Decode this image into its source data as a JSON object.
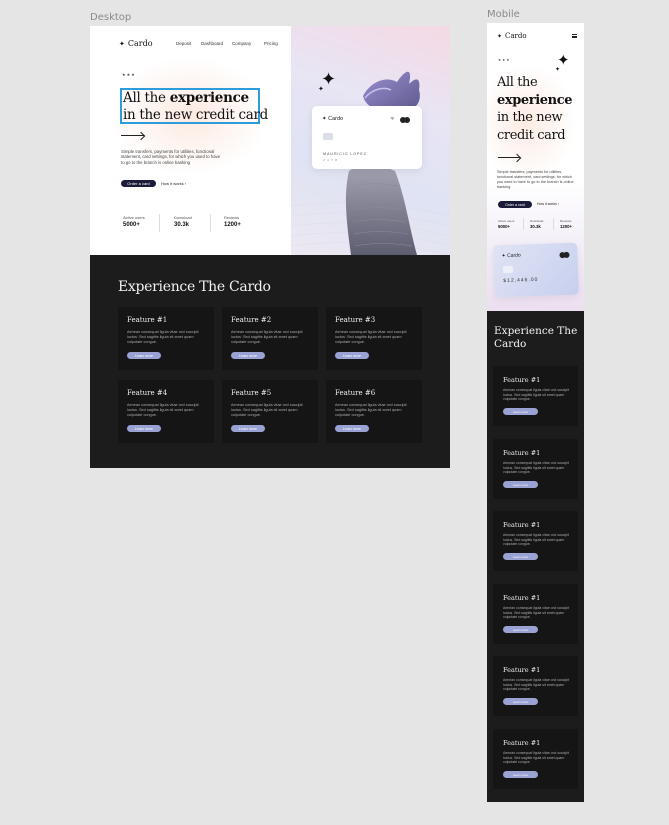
{
  "frames": {
    "desktop_label": "Desktop",
    "mobile_label": "Mobile"
  },
  "brand": {
    "logo": "Cardo",
    "logo_mark": "✦"
  },
  "nav": {
    "items": [
      "Deposit",
      "Dashboard",
      "Company",
      "Pricing"
    ]
  },
  "hero": {
    "rating": "★★★",
    "headline_pre": "All the",
    "headline_bold": "experience",
    "headline_post": "in the new credit card",
    "mobile_lines": [
      "All the",
      "experience",
      "in the new",
      "credit card"
    ],
    "description": "Simple transfers, payments for utilities, functional statement, card settings, for which you used to have to go to the branch is online banking",
    "mobile_description": "Simple transfers, payments for utilities, functional statement, card settings, for which you used to have to go to the branch is online banking",
    "cta_primary": "Order a card",
    "cta_secondary": "How it works",
    "cta_secondary_arrow": "›"
  },
  "stats": [
    {
      "label": "Active users",
      "value": "5000+"
    },
    {
      "label": "Download",
      "value": "30.3k"
    },
    {
      "label": "Reviews",
      "value": "1200+"
    }
  ],
  "card": {
    "logo": "Cardo",
    "holder": "MAURICIO LOPEZ",
    "number": "2 4 7 8",
    "amount": "$12,446.00",
    "icon_card": "▯"
  },
  "features_section": {
    "title": "Experience The Cardo",
    "desktop": [
      {
        "title": "Feature #1",
        "desc": "Aenean consequat ligula vitae orci suscipit luctus. Sed sagittis ligula sit amet quam vulputate congue.",
        "button": "Learn more"
      },
      {
        "title": "Feature #2",
        "desc": "Aenean consequat ligula vitae orci suscipit luctus. Sed sagittis ligula sit amet quam vulputate congue.",
        "button": "Learn more"
      },
      {
        "title": "Feature #3",
        "desc": "Aenean consequat ligula vitae orci suscipit luctus. Sed sagittis ligula sit amet quam vulputate congue.",
        "button": "Learn more"
      },
      {
        "title": "Feature #4",
        "desc": "Aenean consequat ligula vitae orci suscipit luctus. Sed sagittis ligula sit amet quam vulputate congue.",
        "button": "Learn more"
      },
      {
        "title": "Feature #5",
        "desc": "Aenean consequat ligula vitae orci suscipit luctus. Sed sagittis ligula sit amet quam vulputate congue.",
        "button": "Learn more"
      },
      {
        "title": "Feature #6",
        "desc": "Aenean consequat ligula vitae orci suscipit luctus. Sed sagittis ligula sit amet quam vulputate congue.",
        "button": "Learn more"
      }
    ],
    "mobile": [
      {
        "title": "Feature #1",
        "desc": "Aenean consequat ligula vitae orci suscipit luctus. Sed sagittis ligula sit amet quam vulputate congue.",
        "button": "Learn more"
      },
      {
        "title": "Feature #1",
        "desc": "Aenean consequat ligula vitae orci suscipit luctus. Sed sagittis ligula sit amet quam vulputate congue.",
        "button": "Learn more"
      },
      {
        "title": "Feature #1",
        "desc": "Aenean consequat ligula vitae orci suscipit luctus. Sed sagittis ligula sit amet quam vulputate congue.",
        "button": "Learn more"
      },
      {
        "title": "Feature #1",
        "desc": "Aenean consequat ligula vitae orci suscipit luctus. Sed sagittis ligula sit amet quam vulputate congue.",
        "button": "Learn more"
      },
      {
        "title": "Feature #1",
        "desc": "Aenean consequat ligula vitae orci suscipit luctus. Sed sagittis ligula sit amet quam vulputate congue.",
        "button": "Learn more"
      },
      {
        "title": "Feature #1",
        "desc": "Aenean consequat ligula vitae orci suscipit luctus. Sed sagittis ligula sit amet quam vulputate congue.",
        "button": "Learn more"
      }
    ]
  },
  "colors": {
    "canvas": "#e5e5e5",
    "dark": "#1c1c1c",
    "feature_bg": "#151515",
    "accent": "#9aa2d4",
    "button_dark": "#1b1b3a",
    "selection": "#2d9cdb"
  },
  "icons": {
    "sparkle": "sparkle-icon",
    "hand": "hand-illustration",
    "menu": "hamburger-icon",
    "mastercard": "mastercard-icon",
    "contactless": "contactless-icon"
  }
}
